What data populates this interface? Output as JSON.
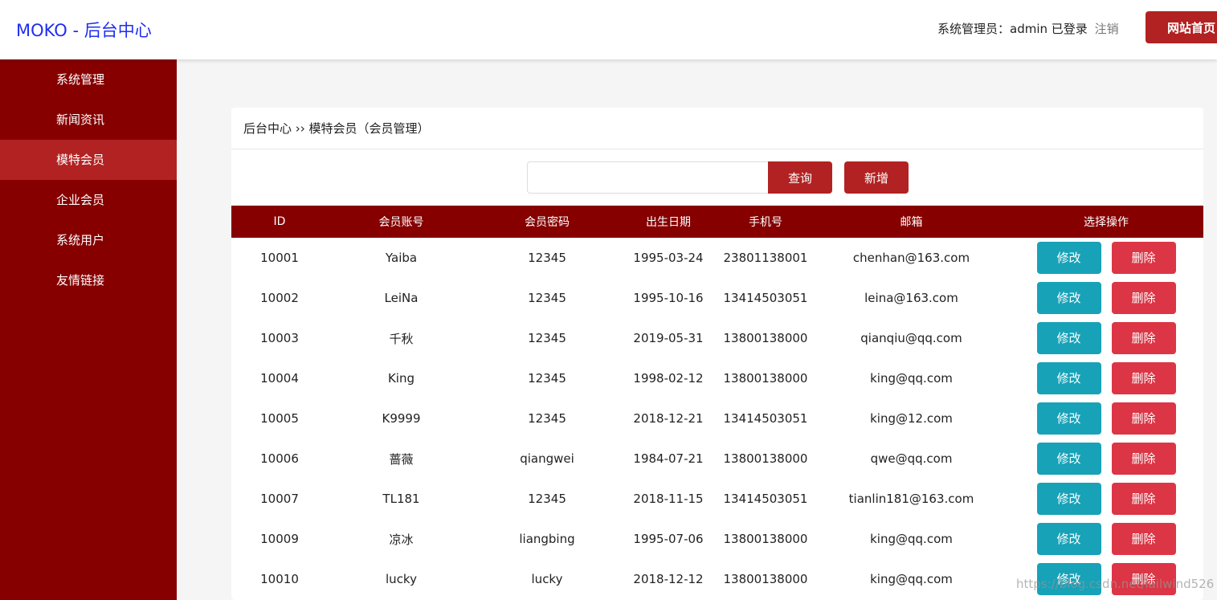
{
  "header": {
    "brand": "MOKO - 后台中心",
    "user_text": "系统管理员：admin 已登录",
    "logout": "注销",
    "home_button": "网站首页"
  },
  "sidebar": {
    "items": [
      {
        "label": "系统管理",
        "active": false
      },
      {
        "label": "新闻资讯",
        "active": false
      },
      {
        "label": "模特会员",
        "active": true
      },
      {
        "label": "企业会员",
        "active": false
      },
      {
        "label": "系统用户",
        "active": false
      },
      {
        "label": "友情链接",
        "active": false
      }
    ]
  },
  "breadcrumb": "后台中心 ›› 模特会员（会员管理）",
  "search": {
    "value": "",
    "query_button": "查询",
    "add_button": "新增"
  },
  "table": {
    "headers": [
      "ID",
      "会员账号",
      "会员密码",
      "出生日期",
      "手机号",
      "邮箱",
      "选择操作"
    ],
    "edit_label": "修改",
    "delete_label": "删除",
    "rows": [
      [
        "10001",
        "Yaiba",
        "12345",
        "1995-03-24",
        "23801138001",
        "chenhan@163.com"
      ],
      [
        "10002",
        "LeiNa",
        "12345",
        "1995-10-16",
        "13414503051",
        "leina@163.com"
      ],
      [
        "10003",
        "千秋",
        "12345",
        "2019-05-31",
        "13800138000",
        "qianqiu@qq.com"
      ],
      [
        "10004",
        "King",
        "12345",
        "1998-02-12",
        "13800138000",
        "king@qq.com"
      ],
      [
        "10005",
        "K9999",
        "12345",
        "2018-12-21",
        "13414503051",
        "king@12.com"
      ],
      [
        "10006",
        "蔷薇",
        "qiangwei",
        "1984-07-21",
        "13800138000",
        "qwe@qq.com"
      ],
      [
        "10007",
        "TL181",
        "12345",
        "2018-11-15",
        "13414503051",
        "tianlin181@163.com"
      ],
      [
        "10009",
        "凉冰",
        "liangbing",
        "1995-07-06",
        "13800138000",
        "king@qq.com"
      ],
      [
        "10010",
        "lucky",
        "lucky",
        "2018-12-12",
        "13800138000",
        "king@qq.com"
      ]
    ]
  },
  "watermark": "https://blog.csdn.net/lailwind526"
}
